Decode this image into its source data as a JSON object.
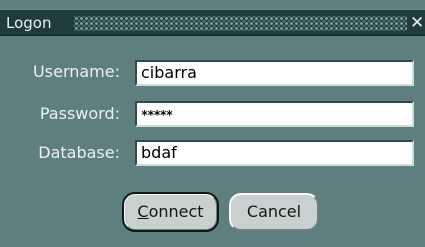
{
  "window": {
    "title": "Logon",
    "close_glyph": "✕"
  },
  "form": {
    "username_label": "Username:",
    "username_value": "cibarra",
    "password_label": "Password:",
    "password_value": "*****",
    "database_label": "Database:",
    "database_value": "bdaf"
  },
  "buttons": {
    "connect_label": "Connect",
    "cancel_label": "Cancel"
  },
  "colors": {
    "dialog_background": "#5f7f7f",
    "titlebar_background": "#1f3b3b",
    "button_face": "#c8d0d0"
  }
}
